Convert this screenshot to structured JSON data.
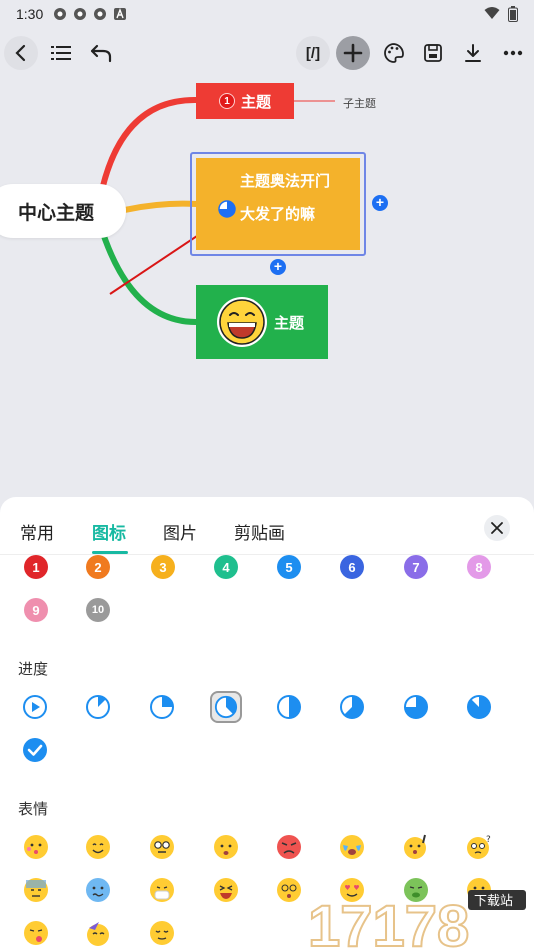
{
  "status": {
    "time": "1:30"
  },
  "toolbar": {
    "format_label": "[/]"
  },
  "mindmap": {
    "root": "中心主题",
    "red_node": {
      "badge": "1",
      "label": "主题"
    },
    "sub_topic": "子主题",
    "orange_node": {
      "line1": "主题奥法开门",
      "line2": "大发了的嘛"
    },
    "green_node": {
      "label": "主题"
    }
  },
  "panel": {
    "tabs": [
      "常用",
      "图标",
      "图片",
      "剪贴画"
    ],
    "active_tab": "图标",
    "sections": {
      "progress": "进度",
      "emoji": "表情"
    },
    "numbers": [
      "1",
      "2",
      "3",
      "4",
      "5",
      "6",
      "7",
      "8",
      "9",
      "10"
    ]
  },
  "watermark": {
    "text": "17178",
    "sub": "下载站"
  },
  "colors": {
    "accent": "#17b9a2",
    "red": "#ee3b34",
    "orange": "#f4b22b",
    "green": "#22b14c",
    "blue": "#1d6ff2"
  }
}
